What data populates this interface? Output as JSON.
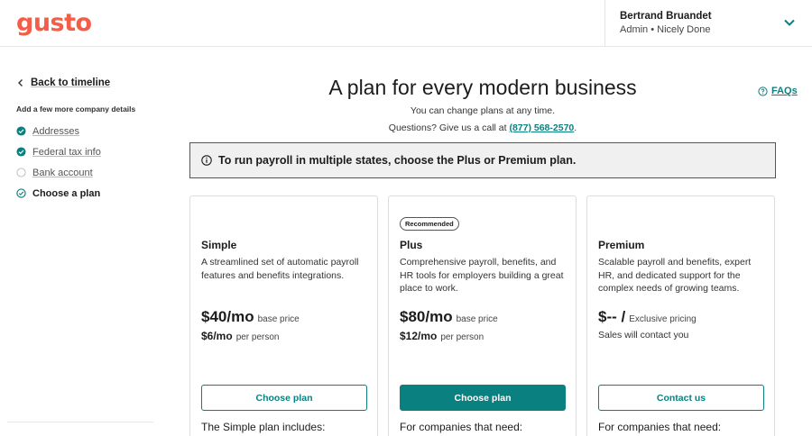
{
  "brand": {
    "logo_text": "gusto",
    "logo_color": "#f45d48",
    "accent_color": "#0a8080"
  },
  "user": {
    "name": "Bertrand Bruandet",
    "subtitle": "Admin • Nicely Done",
    "menu_icon": "chevron-down-icon"
  },
  "sidebar": {
    "back_label": "Back to timeline",
    "caption": "Add a few more company details",
    "steps": [
      {
        "label": "Addresses",
        "status": "complete"
      },
      {
        "label": "Federal tax info",
        "status": "complete"
      },
      {
        "label": "Bank account",
        "status": "incomplete"
      },
      {
        "label": "Choose a plan",
        "status": "current"
      }
    ]
  },
  "main": {
    "title": "A plan for every modern business",
    "subtitle": "You can change plans at any time.",
    "call_prefix": "Questions? Give us a call at",
    "phone": "(877) 568-2570",
    "call_suffix": ".",
    "faq_label": "FAQs",
    "notice": "To run payroll in multiple states, choose the Plus or Premium plan."
  },
  "plans": [
    {
      "name": "Simple",
      "description": "A streamlined set of automatic payroll features and benefits integrations.",
      "price": "$40/mo",
      "price_label": "base price",
      "per_person_price": "$6/mo",
      "per_person_label": "per person",
      "button": "Choose plan",
      "footer": "The Simple plan includes:"
    },
    {
      "badge": "Recommended",
      "name": "Plus",
      "description": "Comprehensive payroll, benefits, and HR tools for employers building a great place to work.",
      "price": "$80/mo",
      "price_label": "base price",
      "per_person_price": "$12/mo",
      "per_person_label": "per person",
      "button": "Choose plan",
      "footer": "For companies that need:"
    },
    {
      "name": "Premium",
      "description": "Scalable payroll and benefits, expert HR, and dedicated support for the complex needs of growing teams.",
      "price": "$-- /",
      "price_label": "Exclusive pricing",
      "sales_note": "Sales will contact you",
      "button": "Contact us",
      "footer": "For companies that need:"
    }
  ]
}
